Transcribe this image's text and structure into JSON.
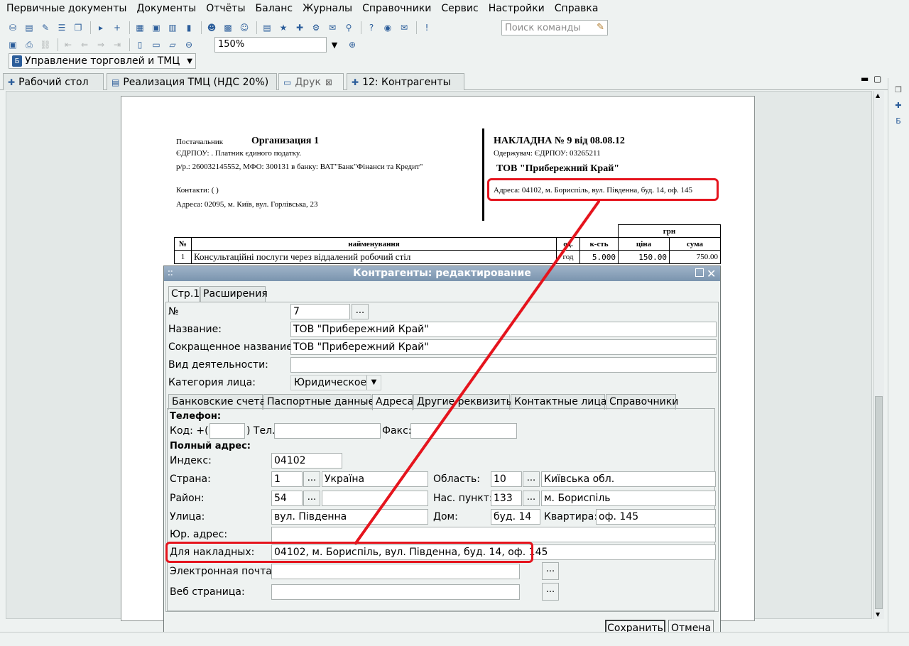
{
  "menu": [
    "Первичные документы",
    "Документы",
    "Отчёты",
    "Баланс",
    "Журналы",
    "Справочники",
    "Сервис",
    "Настройки",
    "Справка"
  ],
  "toolbar": {
    "command_search_placeholder": "Поиск команды",
    "zoom_value": "150%",
    "module_selector": "Управление торговлей и ТМЦ"
  },
  "tabs": [
    {
      "label": "Рабочий стол",
      "icon": "desktop-icon"
    },
    {
      "label": "Реализация ТМЦ (НДС 20%)",
      "icon": "document-icon"
    },
    {
      "label": "Друк",
      "icon": "print-window-icon",
      "closable": true
    },
    {
      "label": "12: Контрагенты",
      "icon": "list-icon"
    }
  ],
  "document": {
    "supplier_label": "Постачальник",
    "supplier_name": "Организация 1",
    "edrpou_line": "ЄДРПОУ: . Платник єдиного податку.",
    "account_line": "р/р.: 260032145552, МФО: 300131 в банку: ВАТ\"Банк\"Фінанси та Кредит\"",
    "contacts_line": "Контакти: ( )",
    "supplier_address": "Адреса: 02095, м. Київ, вул. Горлівська, 23",
    "invoice_title": "НАКЛАДНА № 9 від 08.08.12",
    "receiver_line": "Одержувач: ЄДРПОУ: 03265211",
    "receiver_name": "ТОВ \"Прибережний Край\"",
    "receiver_address": "Адреса: 04102, м. Бориспіль, вул. Південна, буд. 14, оф. 145",
    "table": {
      "currency": "грн",
      "headers": [
        "№",
        "найменування",
        "од.",
        "к-сть",
        "ціна",
        "сума"
      ],
      "rows": [
        [
          "1",
          "Консультаційні послуги через віддалений робочий стіл",
          "год",
          "5.000",
          "150.00",
          "750.00"
        ]
      ]
    }
  },
  "dialog": {
    "title": "Контрагенты: редактирование",
    "page_tabs": [
      "Стр.1",
      "Расширения"
    ],
    "fields": {
      "number_label": "№",
      "number_value": "7",
      "name_label": "Название:",
      "name_value": "ТОВ \"Прибережний Край\"",
      "short_name_label": "Сокращенное название:",
      "short_name_value": "ТОВ \"Прибережний Край\"",
      "activity_label": "Вид деятельности:",
      "activity_value": "",
      "category_label": "Категория лица:",
      "category_value": "Юридическое"
    },
    "sub_tabs": [
      "Банковские счета",
      "Паспортные данные",
      "Адреса",
      "Другие реквизиты",
      "Контактные лица",
      "Справочники"
    ],
    "address": {
      "phone_heading": "Телефон:",
      "code_label": "Код:  +(",
      "code_value": "",
      "tel_label": ") Тел.",
      "tel_value": "",
      "fax_label": "Факс:",
      "fax_value": "",
      "full_address_heading": "Полный адрес:",
      "index_label": "Индекс:",
      "index_value": "04102",
      "country_label": "Страна:",
      "country_code": "1",
      "country_name": "Україна",
      "region_label": "Область:",
      "region_code": "10",
      "region_name": "Київська обл.",
      "district_label": "Район:",
      "district_code": "54",
      "district_name": "",
      "locality_label": "Нас. пункт:",
      "locality_code": "133",
      "locality_name": "м. Бориспіль",
      "street_label": "Улица:",
      "street_value": "вул. Південна",
      "house_label": "Дом:",
      "house_value": "буд. 14",
      "apartment_label": "Квартира:",
      "apartment_value": "оф. 145",
      "legal_address_label": "Юр. адрес:",
      "legal_address_value": "",
      "invoice_address_label": "Для накладных:",
      "invoice_address_value": "04102, м. Бориспіль, вул. Південна, буд. 14, оф. 145",
      "email_label": "Электронная почта:",
      "email_value": "",
      "web_label": "Веб страница:",
      "web_value": ""
    },
    "buttons": {
      "save": "Сохранить",
      "cancel": "Отмена"
    },
    "ellipsis": "..."
  },
  "colors": {
    "highlight": "#e5141d",
    "dialog_title": "#8aa2bb"
  }
}
